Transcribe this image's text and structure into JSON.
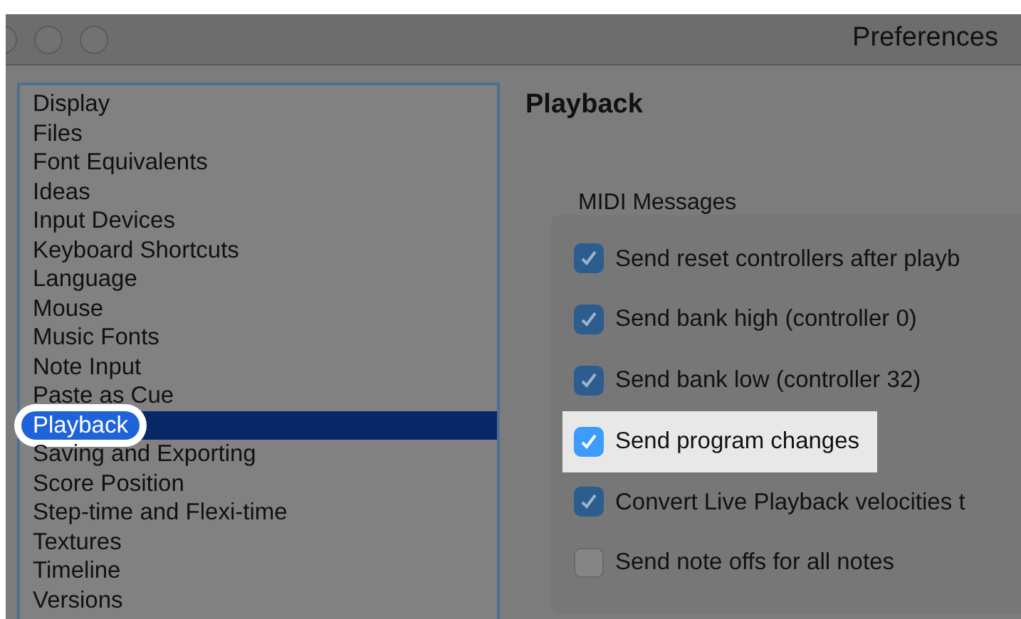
{
  "window": {
    "title": "Preferences"
  },
  "sidebar": {
    "items": [
      {
        "label": "Display",
        "selected": false,
        "highlighted": false
      },
      {
        "label": "Files",
        "selected": false,
        "highlighted": false
      },
      {
        "label": "Font Equivalents",
        "selected": false,
        "highlighted": false
      },
      {
        "label": "Ideas",
        "selected": false,
        "highlighted": false
      },
      {
        "label": "Input Devices",
        "selected": false,
        "highlighted": false
      },
      {
        "label": "Keyboard Shortcuts",
        "selected": false,
        "highlighted": false
      },
      {
        "label": "Language",
        "selected": false,
        "highlighted": false
      },
      {
        "label": "Mouse",
        "selected": false,
        "highlighted": false
      },
      {
        "label": "Music Fonts",
        "selected": false,
        "highlighted": false
      },
      {
        "label": "Note Input",
        "selected": false,
        "highlighted": false
      },
      {
        "label": "Paste as Cue",
        "selected": false,
        "highlighted": false
      },
      {
        "label": "Playback",
        "selected": true,
        "highlighted": true
      },
      {
        "label": "Saving and Exporting",
        "selected": false,
        "highlighted": false
      },
      {
        "label": "Score Position",
        "selected": false,
        "highlighted": false
      },
      {
        "label": "Step-time and Flexi-time",
        "selected": false,
        "highlighted": false
      },
      {
        "label": "Textures",
        "selected": false,
        "highlighted": false
      },
      {
        "label": "Timeline",
        "selected": false,
        "highlighted": false
      },
      {
        "label": "Versions",
        "selected": false,
        "highlighted": false
      }
    ]
  },
  "panel": {
    "title": "Playback",
    "group": {
      "title": "MIDI Messages",
      "options": [
        {
          "label": "Send reset controllers after playb",
          "checked": true,
          "highlighted": false
        },
        {
          "label": "Send bank high (controller 0)",
          "checked": true,
          "highlighted": false
        },
        {
          "label": "Send bank low (controller 32)",
          "checked": true,
          "highlighted": false
        },
        {
          "label": "Send program changes",
          "checked": true,
          "highlighted": true
        },
        {
          "label": "Convert Live Playback velocities t",
          "checked": true,
          "highlighted": false
        },
        {
          "label": "Send note offs for all notes",
          "checked": false,
          "highlighted": false
        }
      ]
    }
  }
}
